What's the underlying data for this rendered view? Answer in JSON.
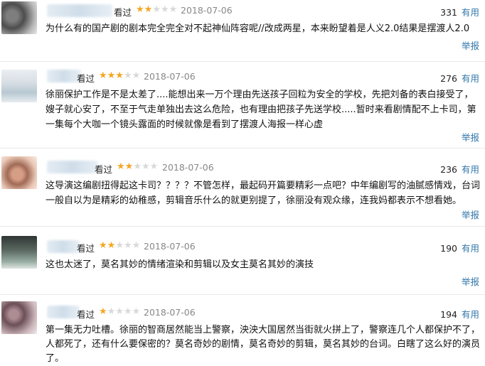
{
  "comments": [
    {
      "label": "看过",
      "rating": 2,
      "date": "2018-07-06",
      "votes": "331",
      "useful": "有用",
      "text": "为什么有的国产剧的剧本完全完全对不起神仙阵容呢//改成两星，本来盼望着是人义2.0结果是摆渡人2.0",
      "report": "举报"
    },
    {
      "label": "看过",
      "rating": 3,
      "date": "2018-07-06",
      "votes": "276",
      "useful": "有用",
      "text": "徐丽保护工作是不是太差了....能想出来一万个理由先送孩子回粒为安全的学校，先把刘备的表白接受了，嫂子就心安了，不至于气走单独出去这么危险，也有理由把孩子先送学校.....暂时来看剧情配不上卡司，第一集每个大咖一个镜头露面的时候就像是看到了摆渡人海报一样心虚",
      "report": "举报"
    },
    {
      "label": "看过",
      "rating": 2,
      "date": "2018-07-06",
      "votes": "236",
      "useful": "有用",
      "text": "这导演这编剧扭得起这卡司？？？？不管怎样，最起码开篇要精彩一点吧？中年编剧写的油腻感情戏，台词一般自以为是精彩的幼稚感，剪辑音乐什么的就更别提了，徐丽没有观众缘，连我妈都表示不想看她。",
      "report": "举报"
    },
    {
      "label": "看过",
      "rating": 2,
      "date": "2018-07-06",
      "votes": "190",
      "useful": "有用",
      "text": "这也太迷了，莫名其妙的情绪渲染和剪辑以及女主莫名其妙的演技",
      "report": "举报"
    },
    {
      "label": "看过",
      "rating": 1,
      "date": "2018-07-06",
      "votes": "194",
      "useful": "有用",
      "text": "第一集无力吐槽。徐丽的智商居然能当上警察，泱泱大国居然当街就火拼上了，警察连几个人都保护不了，人都死了，还有什么要保密的？莫名奇妙的剧情，莫名奇妙的剪辑，莫名其妙的台词。白瞎了这么好的演员了。",
      "report": ""
    }
  ]
}
